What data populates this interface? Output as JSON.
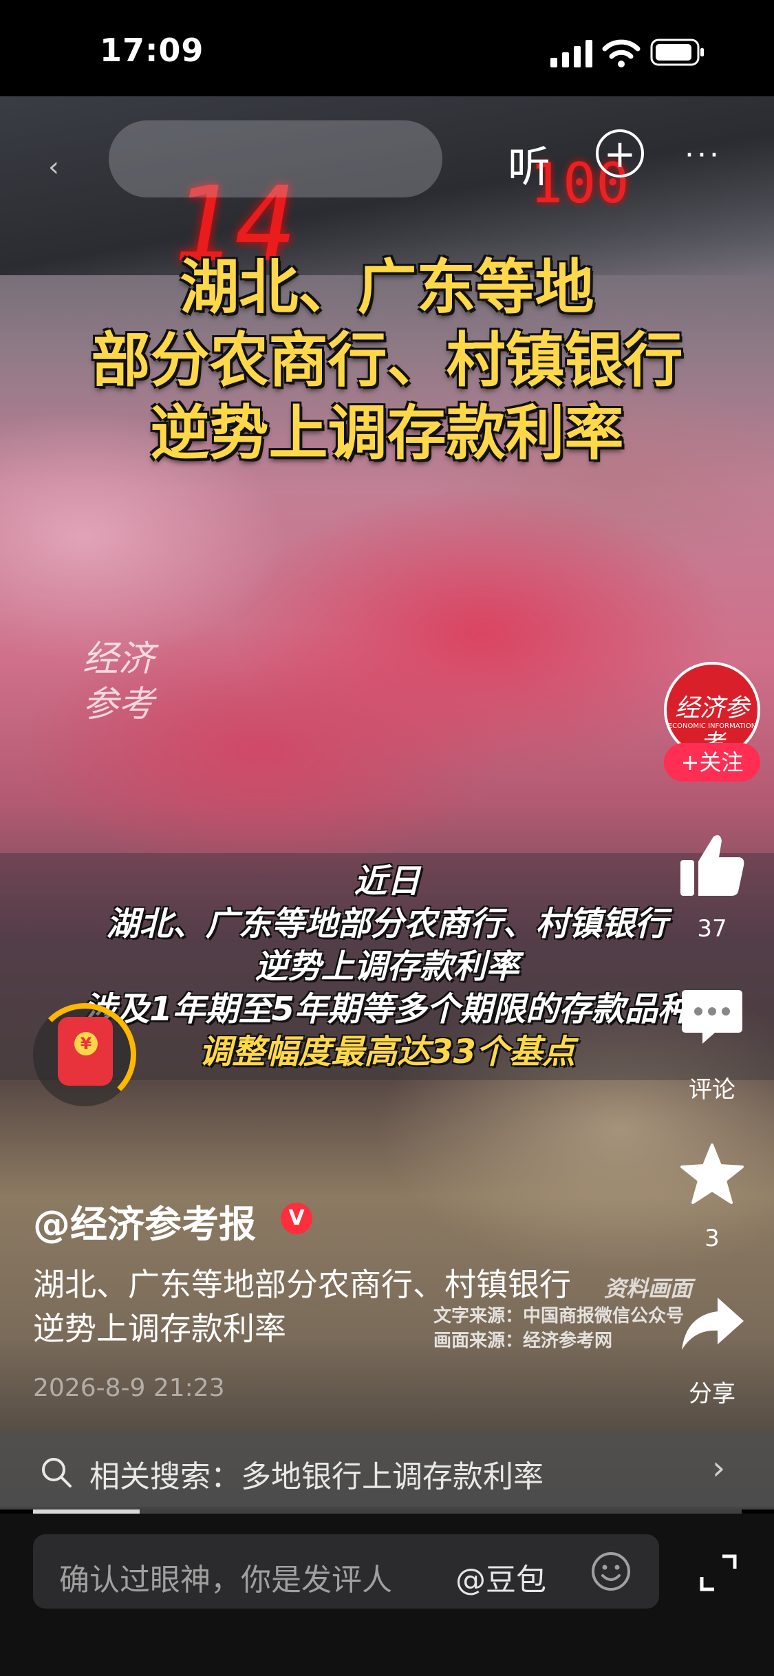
{
  "status_bar": {
    "time": "17:09"
  },
  "video": {
    "display_left": "14",
    "display_right": "100",
    "headline": [
      "湖北、广东等地",
      "部分农商行、村镇银行",
      "逆势上调存款利率"
    ],
    "watermark": [
      "经济",
      "参考"
    ],
    "caption_lines": [
      "近日",
      "湖北、广东等地部分农商行、村镇银行",
      "逆势上调存款利率",
      "涉及1年期至5年期等多个期限的存款品种"
    ],
    "caption_highlight": "调整幅度最高达33个基点"
  },
  "top_bar": {
    "listen_label": "听",
    "add_label": "+",
    "more_label": "···"
  },
  "right_rail": {
    "avatar_text": "经济参考",
    "avatar_sub": "ECONOMIC INFORMATION",
    "follow_label": "+关注",
    "like_count": "37",
    "comment_label": "评论",
    "favorite_count": "3",
    "share_label": "分享"
  },
  "post": {
    "author": "@经济参考报",
    "verified_badge": "V",
    "description": "湖北、广东等地部分农商行、村镇银行逆势上调存款利率",
    "material_note": "资料画面",
    "text_source": "文字来源：中国商报微信公众号",
    "image_source": "画面来源：经济参考网",
    "date": "2026-8-9 21:23"
  },
  "related_search": {
    "text": "相关搜索：多地银行上调存款利率"
  },
  "playback": {
    "progress": 0.15
  },
  "comment_bar": {
    "placeholder": "确认过眼神，你是发评人",
    "mention": "@豆包"
  },
  "colors": {
    "headline": "#ffd84a",
    "accent_red": "#ff2e52"
  }
}
